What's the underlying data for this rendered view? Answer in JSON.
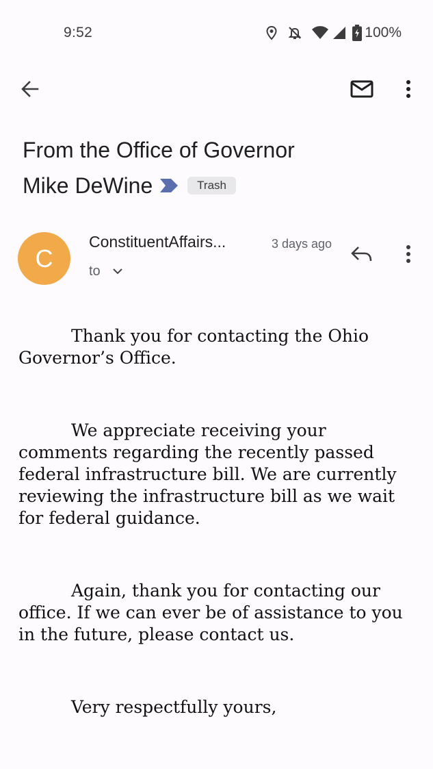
{
  "status_bar": {
    "time": "9:52",
    "battery": "100%",
    "icons": [
      "location-icon",
      "bell-off-icon",
      "wifi-icon",
      "signal-icon",
      "battery-charging-icon"
    ]
  },
  "toolbar": {
    "back_icon": "arrow-back-icon",
    "mark_unread_icon": "mail-icon",
    "more_icon": "more-vert-icon"
  },
  "email": {
    "subject_line1": "From the Office of Governor",
    "subject_line2": "Mike DeWine",
    "label_icon": "important-marker-icon",
    "label_color": "#5b6eae",
    "folder_chip": "Trash",
    "sender": {
      "avatar_letter": "C",
      "avatar_color": "#f2a94a",
      "name": "ConstituentAffairs...",
      "date": "3 days ago",
      "recipients_label": "to"
    },
    "body": {
      "p1_lead": "Thank you for contacting the Ohio",
      "p1_rest": "Governor’s Office.",
      "p2_lead": "We appreciate receiving your",
      "p2_rest": "comments regarding the recently passed federal infrastructure bill. We are currently reviewing the infrastructure bill as we wait for federal guidance.",
      "p3_lead": "Again, thank you for contacting our",
      "p3_rest": "office.  If we can ever be of assistance to you in the future, please contact us.",
      "closing": "Very respectfully yours,"
    }
  }
}
